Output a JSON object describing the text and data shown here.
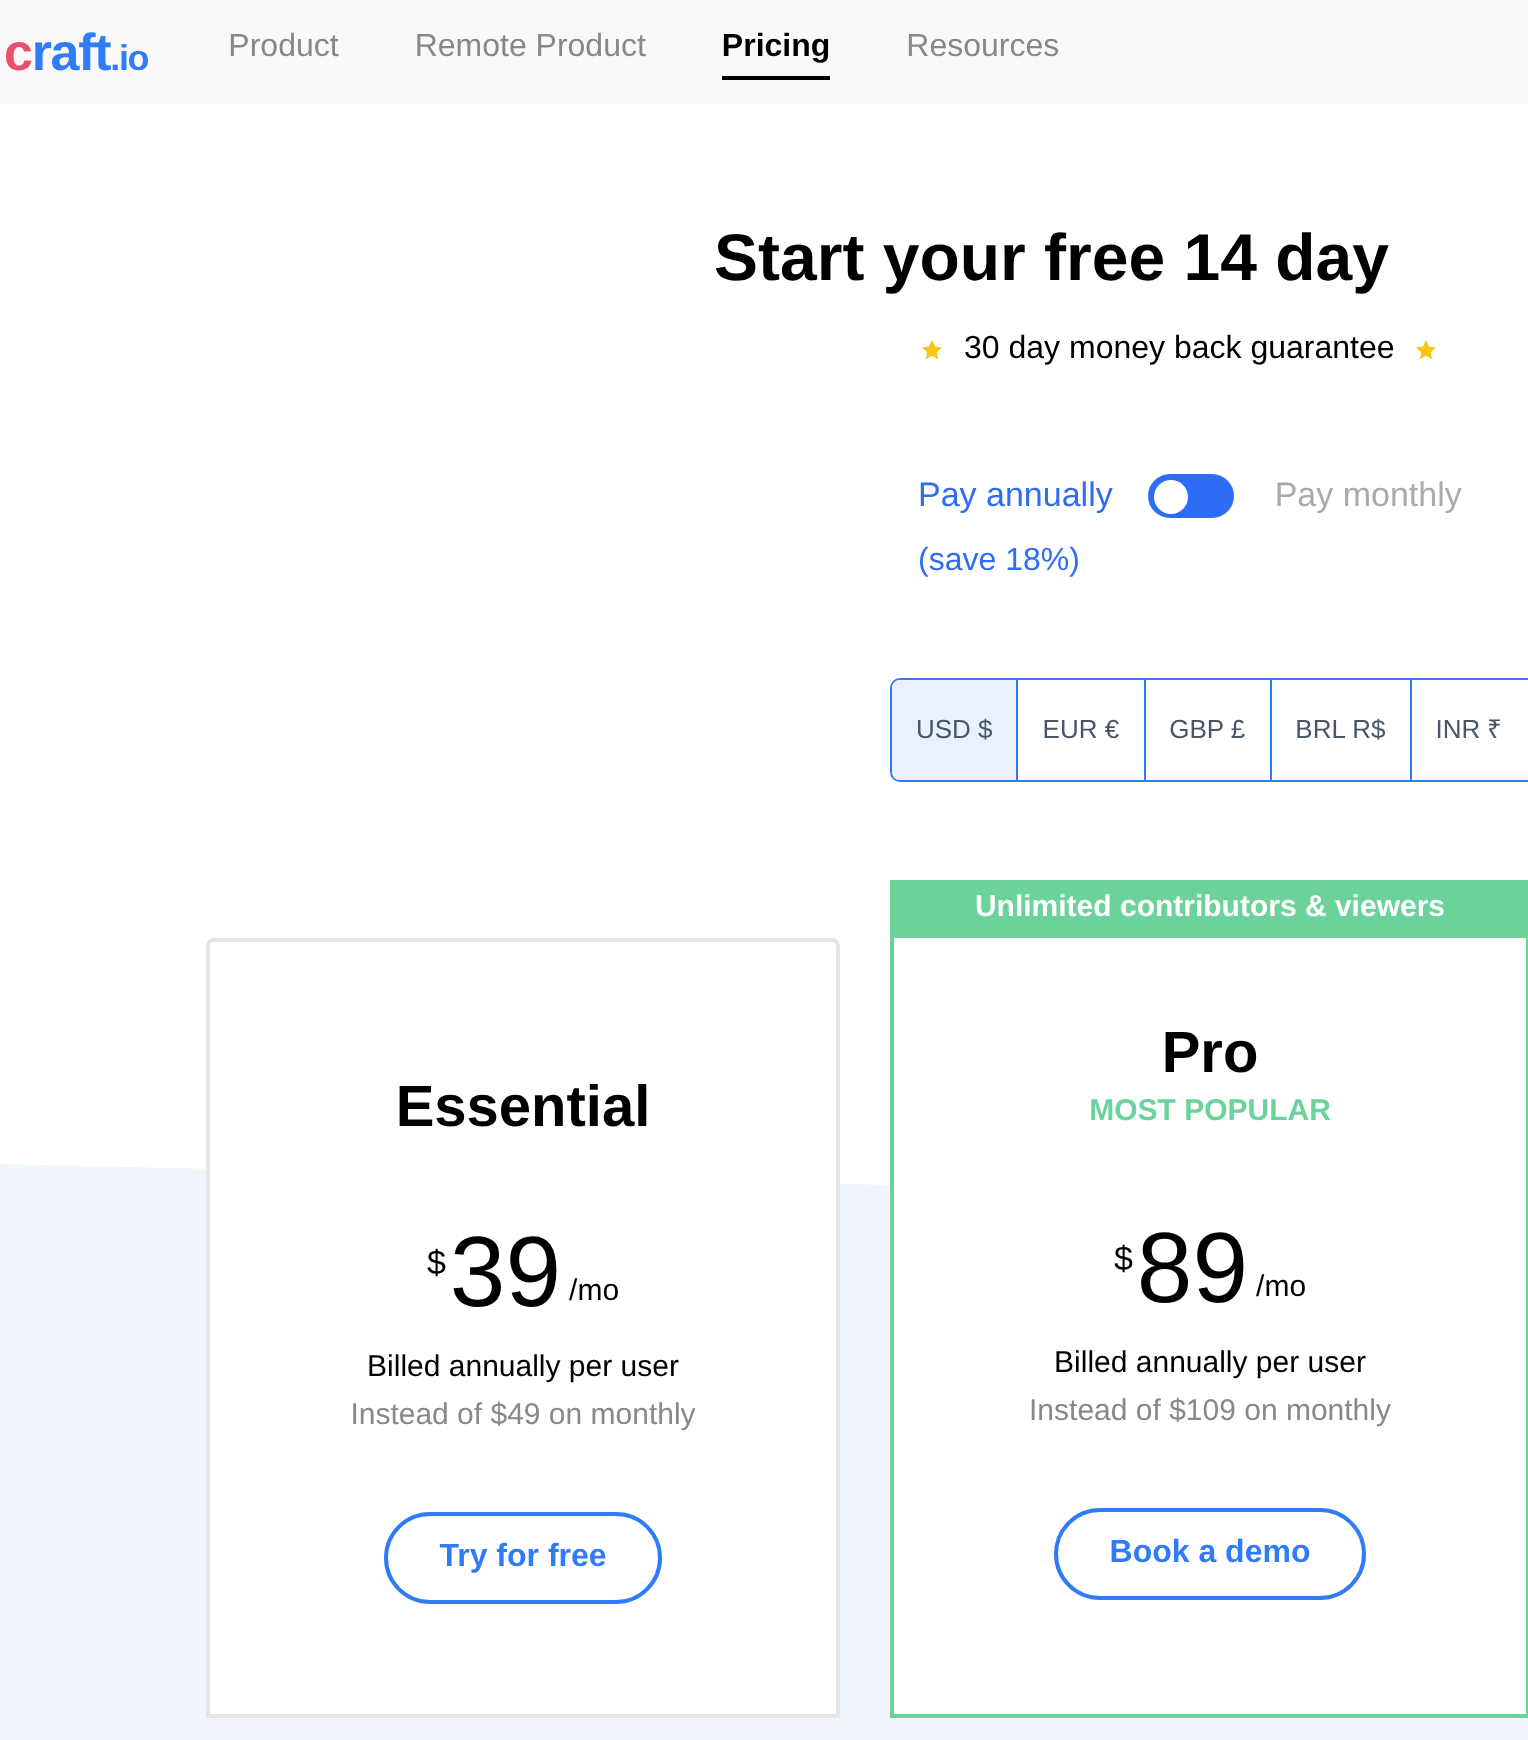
{
  "logo": {
    "name": "craft",
    "suffix": ".io"
  },
  "nav": [
    {
      "label": "Product",
      "selected": false
    },
    {
      "label": "Remote Product",
      "selected": false
    },
    {
      "label": "Pricing",
      "selected": true
    },
    {
      "label": "Resources",
      "selected": false
    }
  ],
  "headline": "Start your free 14 day",
  "guarantee": "30 day money back guarantee",
  "billing": {
    "options": [
      {
        "label": "Pay annually",
        "note": "(save 18%)",
        "selected": true
      },
      {
        "label": "Pay monthly",
        "selected": false
      }
    ]
  },
  "currencies": [
    {
      "label": "USD $",
      "selected": true
    },
    {
      "label": "EUR €",
      "selected": false
    },
    {
      "label": "GBP £",
      "selected": false
    },
    {
      "label": "BRL R$",
      "selected": false
    },
    {
      "label": "INR ₹",
      "selected": false
    }
  ],
  "plans": [
    {
      "name": "Essential",
      "currency": "$",
      "price": "39",
      "period": "/mo",
      "billed": "Billed annually per user",
      "instead": "Instead of $49 on monthly",
      "button": "Try for free"
    },
    {
      "banner": "Unlimited contributors & viewers",
      "name": "Pro",
      "tag": "MOST POPULAR",
      "currency": "$",
      "price": "89",
      "period": "/mo",
      "billed": "Billed annually per user",
      "instead": "Instead of $109 on monthly",
      "button": "Book a demo"
    }
  ]
}
